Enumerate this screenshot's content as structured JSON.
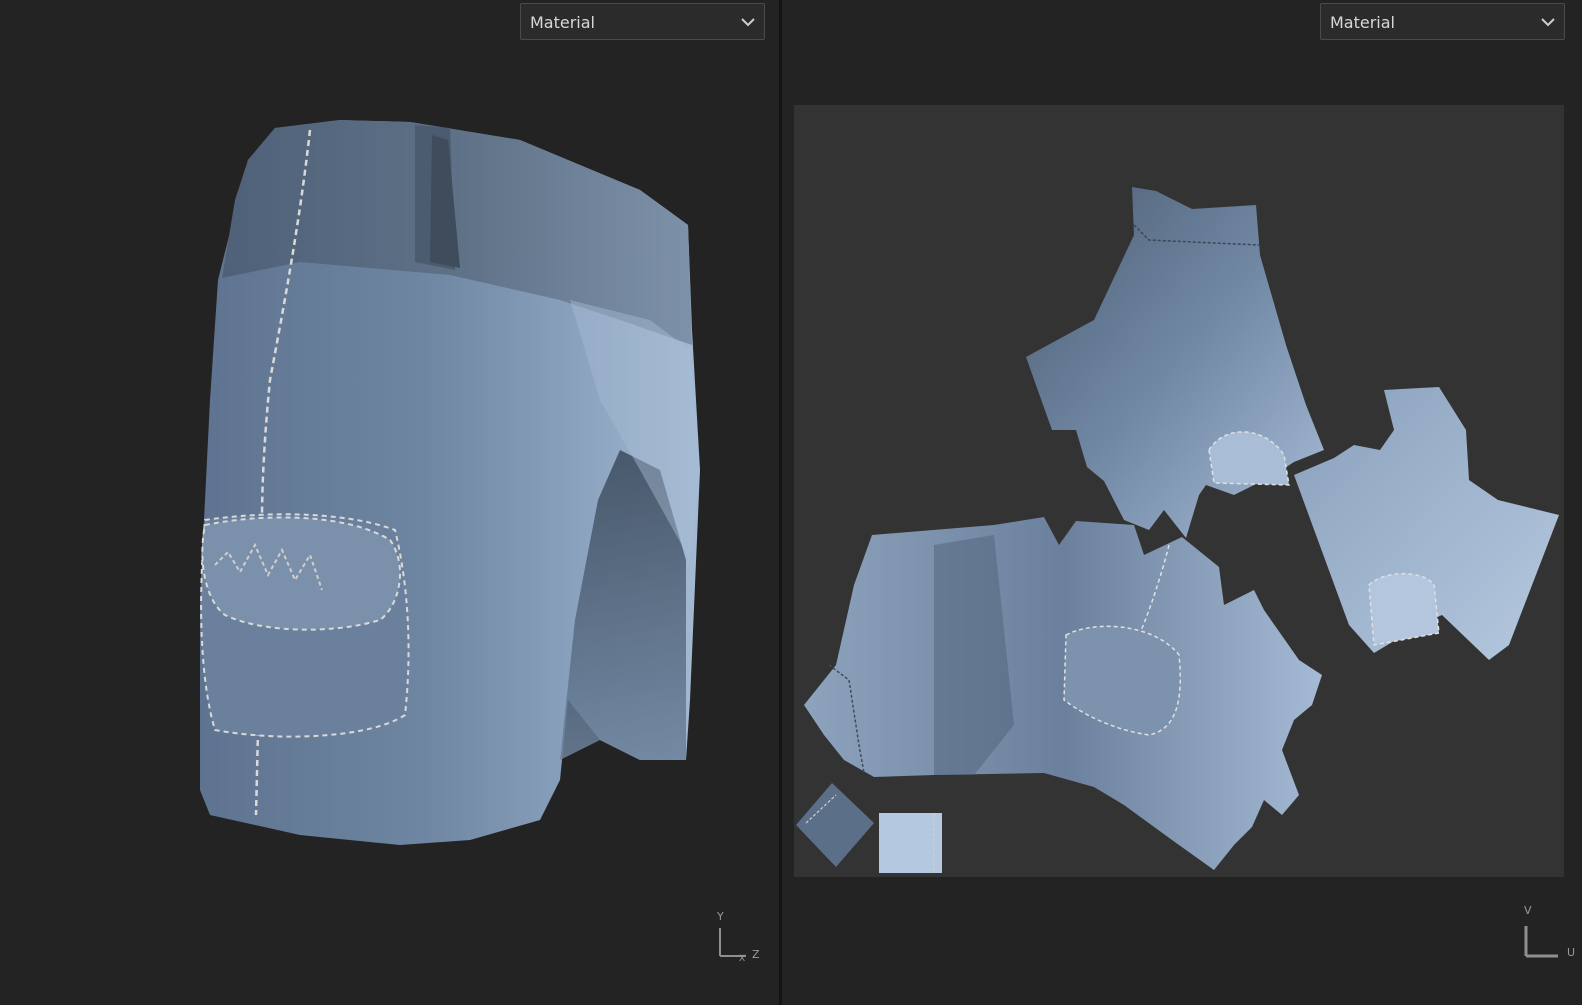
{
  "viewport_3d": {
    "display_mode": "Material",
    "axis": {
      "up": "Y",
      "right": "Z",
      "origin": "X"
    }
  },
  "viewport_uv": {
    "display_mode": "Material",
    "axis": {
      "up": "V",
      "right": "U"
    }
  },
  "colors": {
    "background": "#232323",
    "uv_canvas": "#333333",
    "fabric": "#6f86a3",
    "stitch": "#d9d9d9"
  },
  "icons": {
    "dropdown": "chevron-down-icon",
    "axis_gizmo": "axis-gizmo-icon"
  }
}
